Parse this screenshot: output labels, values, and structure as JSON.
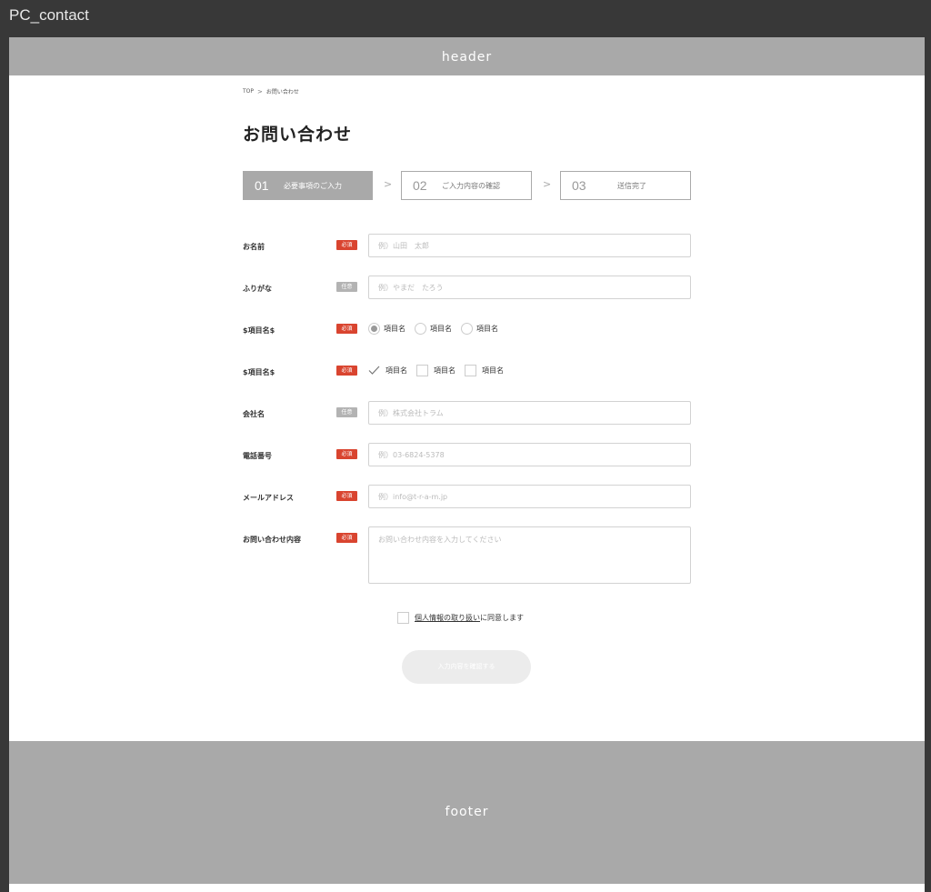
{
  "frame_title": "PC_contact",
  "header": {
    "label": "header"
  },
  "footer": {
    "label": "footer"
  },
  "breadcrumb": {
    "home": "TOP",
    "separator": ">",
    "current": "お問い合わせ"
  },
  "page_title": "お問い合わせ",
  "steps": [
    {
      "num": "01",
      "label": "必要事項のご入力"
    },
    {
      "num": "02",
      "label": "ご入力内容の確認"
    },
    {
      "num": "03",
      "label": "送信完了"
    }
  ],
  "step_arrow": ">",
  "badges": {
    "required": "必須",
    "optional": "任意"
  },
  "form": {
    "name": {
      "label": "お名前",
      "placeholder": "例）山田　太郎"
    },
    "kana": {
      "label": "ふりがな",
      "placeholder": "例）やまだ　たろう"
    },
    "radio_group": {
      "label": "$項目名$",
      "options": [
        "項目名",
        "項目名",
        "項目名"
      ]
    },
    "checkbox_group": {
      "label": "$項目名$",
      "options": [
        "項目名",
        "項目名",
        "項目名"
      ]
    },
    "company": {
      "label": "会社名",
      "placeholder": "例）株式会社トラム"
    },
    "phone": {
      "label": "電話番号",
      "placeholder": "例）03-6824-5378"
    },
    "email": {
      "label": "メールアドレス",
      "placeholder": "例）info@t-r-a-m.jp"
    },
    "inquiry": {
      "label": "お問い合わせ内容",
      "placeholder": "お問い合わせ内容を入力してください"
    }
  },
  "agree": {
    "link": "個人情報の取り扱い",
    "text": "に同意します"
  },
  "submit_label": "入力内容を確認する",
  "colors": {
    "required": "#d9442f",
    "optional": "#b3b3b3",
    "header_footer": "#a9a9a9",
    "step_active": "#a9a9a9"
  }
}
